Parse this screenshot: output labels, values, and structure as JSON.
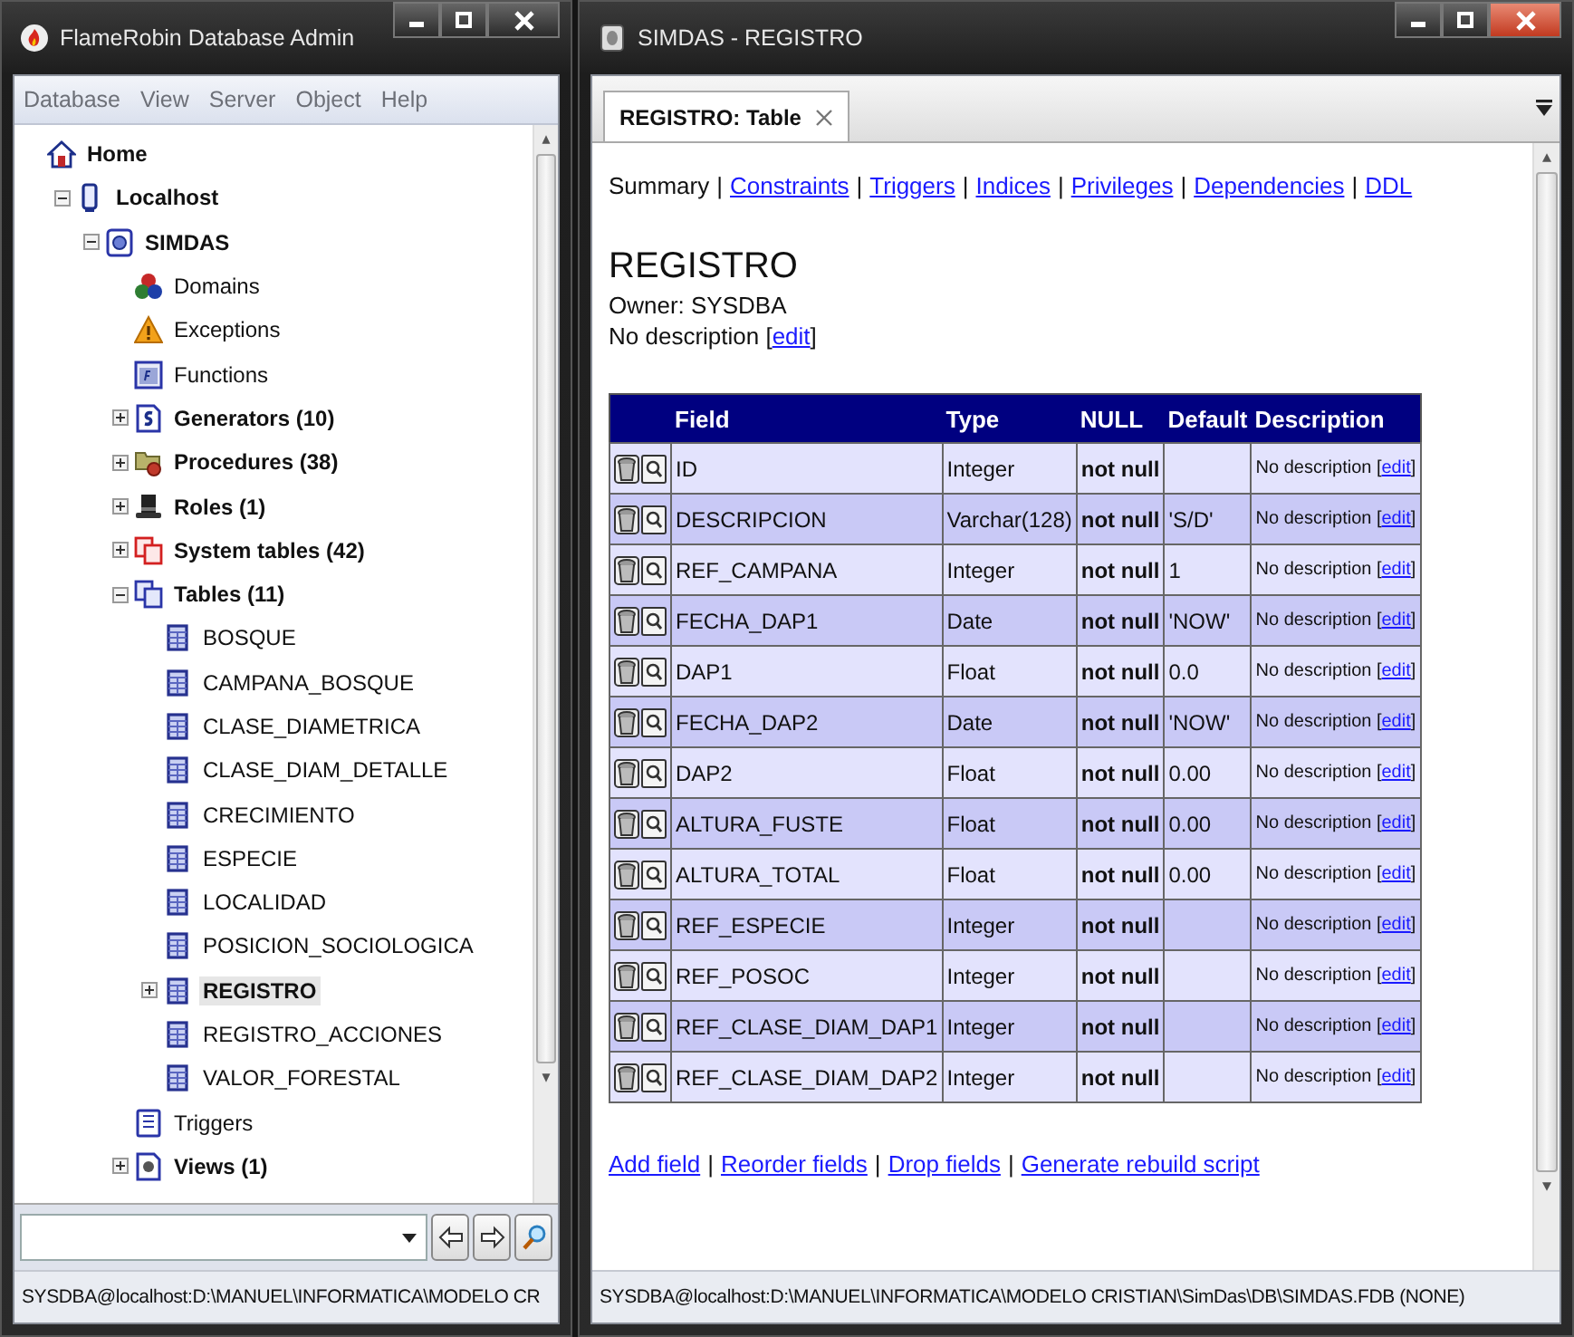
{
  "left_window": {
    "title": "FlameRobin Database Admin",
    "menu": [
      "Database",
      "View",
      "Server",
      "Object",
      "Help"
    ],
    "tree": [
      {
        "label": "Home",
        "kind": "home",
        "bold": true,
        "selected": false,
        "children": [
          {
            "label": "Localhost",
            "kind": "server",
            "bold": true,
            "expanded": true,
            "selected": false,
            "children": [
              {
                "label": "SIMDAS",
                "kind": "database",
                "bold": true,
                "expanded": true,
                "selected": false,
                "children": [
                  {
                    "label": "Domains",
                    "kind": "domains",
                    "bold": false,
                    "selected": false
                  },
                  {
                    "label": "Exceptions",
                    "kind": "exceptions",
                    "bold": false,
                    "selected": false
                  },
                  {
                    "label": "Functions",
                    "kind": "functions",
                    "bold": false,
                    "selected": false
                  },
                  {
                    "label": "Generators (10)",
                    "kind": "generators",
                    "bold": true,
                    "expanded": false,
                    "selected": false
                  },
                  {
                    "label": "Procedures (38)",
                    "kind": "procedures",
                    "bold": true,
                    "expanded": false,
                    "selected": false
                  },
                  {
                    "label": "Roles (1)",
                    "kind": "roles",
                    "bold": true,
                    "expanded": false,
                    "selected": false
                  },
                  {
                    "label": "System tables (42)",
                    "kind": "systables",
                    "bold": true,
                    "expanded": false,
                    "selected": false
                  },
                  {
                    "label": "Tables (11)",
                    "kind": "tables",
                    "bold": true,
                    "expanded": true,
                    "selected": false,
                    "children": [
                      {
                        "label": "BOSQUE",
                        "kind": "table",
                        "bold": false,
                        "selected": false
                      },
                      {
                        "label": "CAMPANA_BOSQUE",
                        "kind": "table",
                        "bold": false,
                        "selected": false
                      },
                      {
                        "label": "CLASE_DIAMETRICA",
                        "kind": "table",
                        "bold": false,
                        "selected": false
                      },
                      {
                        "label": "CLASE_DIAM_DETALLE",
                        "kind": "table",
                        "bold": false,
                        "selected": false
                      },
                      {
                        "label": "CRECIMIENTO",
                        "kind": "table",
                        "bold": false,
                        "selected": false
                      },
                      {
                        "label": "ESPECIE",
                        "kind": "table",
                        "bold": false,
                        "selected": false
                      },
                      {
                        "label": "LOCALIDAD",
                        "kind": "table",
                        "bold": false,
                        "selected": false
                      },
                      {
                        "label": "POSICION_SOCIOLOGICA",
                        "kind": "table",
                        "bold": false,
                        "selected": false
                      },
                      {
                        "label": "REGISTRO",
                        "kind": "table",
                        "bold": true,
                        "expanded": false,
                        "selected": true
                      },
                      {
                        "label": "REGISTRO_ACCIONES",
                        "kind": "table",
                        "bold": false,
                        "selected": false
                      },
                      {
                        "label": "VALOR_FORESTAL",
                        "kind": "table",
                        "bold": false,
                        "selected": false
                      }
                    ]
                  },
                  {
                    "label": "Triggers",
                    "kind": "triggers",
                    "bold": false,
                    "selected": false
                  },
                  {
                    "label": "Views (1)",
                    "kind": "views",
                    "bold": true,
                    "expanded": false,
                    "selected": false
                  }
                ]
              }
            ]
          }
        ]
      }
    ],
    "status_bar": "SYSDBA@localhost:D:\\MANUEL\\INFORMATICA\\MODELO CR"
  },
  "right_window": {
    "title": "SIMDAS - REGISTRO",
    "tabs": [
      {
        "label": "REGISTRO: Table",
        "selected": true
      }
    ],
    "nav": [
      {
        "label": "Summary",
        "selected": true
      },
      {
        "label": "Constraints",
        "selected": false
      },
      {
        "label": "Triggers",
        "selected": false
      },
      {
        "label": "Indices",
        "selected": false
      },
      {
        "label": "Privileges",
        "selected": false
      },
      {
        "label": "Dependencies",
        "selected": false
      },
      {
        "label": "DDL",
        "selected": false
      }
    ],
    "separator": "|",
    "heading": "REGISTRO",
    "owner": "Owner: SYSDBA",
    "description": {
      "before": "No description [",
      "link": "edit",
      "after": "]"
    },
    "table": {
      "columns": [
        "Field",
        "Type",
        "NULL",
        "Default",
        "Description"
      ],
      "rows": [
        {
          "field": "ID",
          "type": "Integer",
          "null": "not null",
          "default": "",
          "description": {
            "before": "No description [",
            "link": "edit",
            "after": "]"
          }
        },
        {
          "field": "DESCRIPCION",
          "type": "Varchar(128)",
          "null": "not null",
          "default": "'S/D'",
          "description": {
            "before": "No description [",
            "link": "edit",
            "after": "]"
          }
        },
        {
          "field": "REF_CAMPANA",
          "type": "Integer",
          "null": "not null",
          "default": "1",
          "description": {
            "before": "No description [",
            "link": "edit",
            "after": "]"
          }
        },
        {
          "field": "FECHA_DAP1",
          "type": "Date",
          "null": "not null",
          "default": "'NOW'",
          "description": {
            "before": "No description [",
            "link": "edit",
            "after": "]"
          }
        },
        {
          "field": "DAP1",
          "type": "Float",
          "null": "not null",
          "default": "0.0",
          "description": {
            "before": "No description [",
            "link": "edit",
            "after": "]"
          }
        },
        {
          "field": "FECHA_DAP2",
          "type": "Date",
          "null": "not null",
          "default": "'NOW'",
          "description": {
            "before": "No description [",
            "link": "edit",
            "after": "]"
          }
        },
        {
          "field": "DAP2",
          "type": "Float",
          "null": "not null",
          "default": "0.00",
          "description": {
            "before": "No description [",
            "link": "edit",
            "after": "]"
          }
        },
        {
          "field": "ALTURA_FUSTE",
          "type": "Float",
          "null": "not null",
          "default": "0.00",
          "description": {
            "before": "No description [",
            "link": "edit",
            "after": "]"
          }
        },
        {
          "field": "ALTURA_TOTAL",
          "type": "Float",
          "null": "not null",
          "default": "0.00",
          "description": {
            "before": "No description [",
            "link": "edit",
            "after": "]"
          }
        },
        {
          "field": "REF_ESPECIE",
          "type": "Integer",
          "null": "not null",
          "default": "",
          "description": {
            "before": "No description [",
            "link": "edit",
            "after": "]"
          }
        },
        {
          "field": "REF_POSOC",
          "type": "Integer",
          "null": "not null",
          "default": "",
          "description": {
            "before": "No description [",
            "link": "edit",
            "after": "]"
          }
        },
        {
          "field": "REF_CLASE_DIAM_DAP1",
          "type": "Integer",
          "null": "not null",
          "default": "",
          "description": {
            "before": "No description [",
            "link": "edit",
            "after": "]"
          }
        },
        {
          "field": "REF_CLASE_DIAM_DAP2",
          "type": "Integer",
          "null": "not null",
          "default": "",
          "description": {
            "before": "No description [",
            "link": "edit",
            "after": "]"
          }
        }
      ]
    },
    "actions": [
      "Add field",
      "Reorder fields",
      "Drop fields",
      "Generate rebuild script"
    ],
    "status_bar": "SYSDBA@localhost:D:\\MANUEL\\INFORMATICA\\MODELO CRISTIAN\\SimDas\\DB\\SIMDAS.FDB (NONE)"
  }
}
